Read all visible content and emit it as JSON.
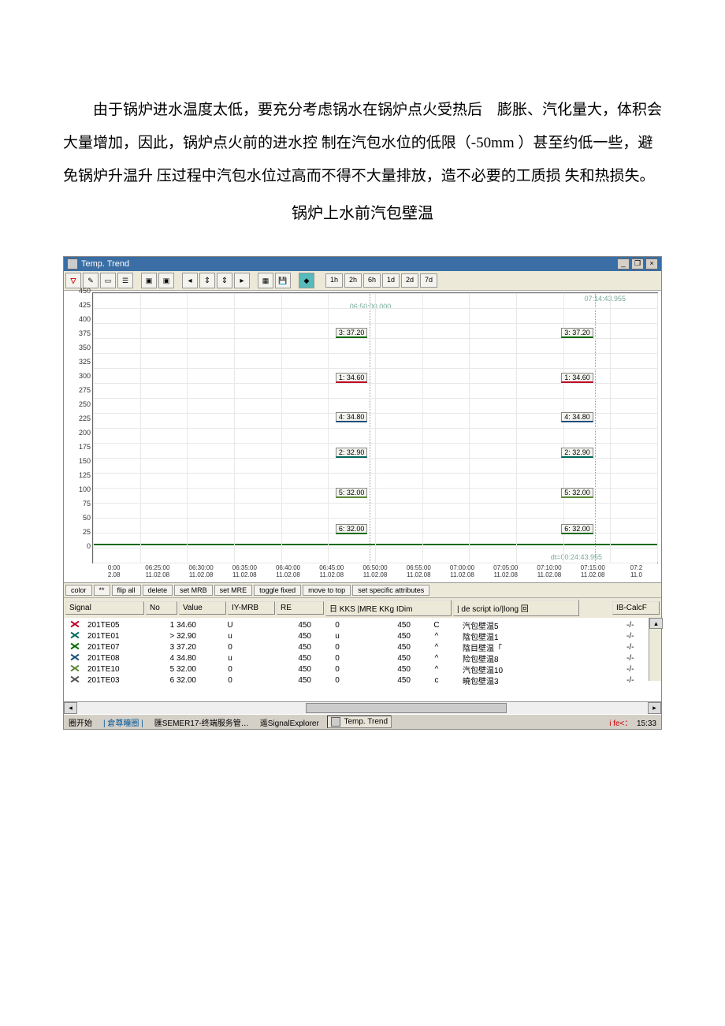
{
  "document": {
    "paragraph": "由于锅炉进水温度太低，要充分考虑锅水在锅炉点火受热后　膨胀、汽化量大，体积会大量增加，因此，锅炉点火前的进水控 制在汽包水位的低限（-50mm ）甚至约低一些，避免锅炉升温升 压过程中汽包水位过高而不得不大量排放，造不必要的工质损 失和热损失。",
    "caption": "锅炉上水前汽包壁温"
  },
  "window": {
    "title": "Temp. Trend",
    "toolbar_time_buttons": [
      "1h",
      "2h",
      "6h",
      "1d",
      "2d",
      "7d"
    ],
    "top_right_label": "07:14:43.955",
    "cursor_time": "06:50:00.000",
    "dt_label": "dt=00:24:43.955"
  },
  "chart_data": {
    "type": "line",
    "ylim": [
      0,
      450
    ],
    "yticks": [
      0,
      25,
      50,
      75,
      100,
      125,
      150,
      175,
      200,
      225,
      250,
      275,
      300,
      325,
      350,
      375,
      400,
      425,
      450
    ],
    "x_ticks": [
      {
        "t": "0:00",
        "d": "2.08"
      },
      {
        "t": "06:25:00",
        "d": "11.02.08"
      },
      {
        "t": "06:30:00",
        "d": "11.02.08"
      },
      {
        "t": "06:35:00",
        "d": "11.02.08"
      },
      {
        "t": "06:40:00",
        "d": "11.02.08"
      },
      {
        "t": "06:45:00",
        "d": "11.02.08"
      },
      {
        "t": "06:50:00",
        "d": "11.02.08"
      },
      {
        "t": "06:55:00",
        "d": "11.02.08"
      },
      {
        "t": "07:00:00",
        "d": "11.02.08"
      },
      {
        "t": "07:05:00",
        "d": "11.02.08"
      },
      {
        "t": "07:10:00",
        "d": "11.02.08"
      },
      {
        "t": "07:15:00",
        "d": "11.02.08"
      },
      {
        "t": "07:2",
        "d": "11.0"
      }
    ],
    "cursor_labels_left": [
      {
        "n": "3",
        "v": "37.20",
        "y": 375,
        "cls": "l3"
      },
      {
        "n": "1",
        "v": "34.60",
        "y": 300,
        "cls": "l1"
      },
      {
        "n": "4",
        "v": "34.80",
        "y": 235,
        "cls": "l4"
      },
      {
        "n": "2",
        "v": "32.90",
        "y": 175,
        "cls": "l2"
      },
      {
        "n": "5",
        "v": "32.00",
        "y": 108,
        "cls": "l5"
      },
      {
        "n": "6",
        "v": "32.00",
        "y": 48,
        "cls": "l6"
      }
    ],
    "cursor_labels_right": [
      {
        "n": "3",
        "v": "37.20",
        "y": 375,
        "cls": "l3"
      },
      {
        "n": "1",
        "v": "34.60",
        "y": 300,
        "cls": "l1"
      },
      {
        "n": "4",
        "v": "34.80",
        "y": 235,
        "cls": "l4"
      },
      {
        "n": "2",
        "v": "32.90",
        "y": 175,
        "cls": "l2"
      },
      {
        "n": "5",
        "v": "32.00",
        "y": 108,
        "cls": "l5"
      },
      {
        "n": "6",
        "v": "32.00",
        "y": 48,
        "cls": "l6"
      }
    ],
    "x_label_prefix": "0:00"
  },
  "button_row": [
    "color",
    "**",
    "flip all",
    "delete",
    "set MRB",
    "set MRE",
    "toggle fixed",
    "move to top",
    "set specific attributes"
  ],
  "header_row": {
    "signal": "Signal",
    "no": "No",
    "value": "Value",
    "ymrb": "IY-MRB",
    "re": "RE",
    "kks": "日 KKS |MRE KKg IDim",
    "desc": "| de script io/|long 回",
    "calc": "IB-CalcF"
  },
  "signals": [
    {
      "cls": "c1",
      "name": "201TE05",
      "no": "1",
      "val": "34.60",
      "c4": "U",
      "c5": "450",
      "c6": "0",
      "c7": "450",
      "c8": "C",
      "desc": "汽包壁温5",
      "calc": "-/-"
    },
    {
      "cls": "c2",
      "name": "201TE01",
      "no": ">",
      "val": "32.90",
      "c4": "u",
      "c5": "450",
      "c6": "u",
      "c7": "450",
      "c8": "^",
      "desc": "陰包壁温1",
      "calc": "-/-"
    },
    {
      "cls": "c3",
      "name": "201TE07",
      "no": "3",
      "val": "37.20",
      "c4": "0",
      "c5": "450",
      "c6": "0",
      "c7": "450",
      "c8": "^",
      "desc": "陰目壁温「",
      "calc": "-/-"
    },
    {
      "cls": "c4",
      "name": "201TE08",
      "no": "4",
      "val": "34.80",
      "c4": "u",
      "c5": "450",
      "c6": "0",
      "c7": "450",
      "c8": "^",
      "desc": "险包壁温8",
      "calc": "-/-"
    },
    {
      "cls": "c5",
      "name": "201TE10",
      "no": "5",
      "val": "32.00",
      "c4": "0",
      "c5": "450",
      "c6": "0",
      "c7": "450",
      "c8": "^",
      "desc": "汽包壁温10",
      "calc": "-/-"
    },
    {
      "cls": "c6",
      "name": "201TE03",
      "no": "6",
      "val": "32.00",
      "c4": "0",
      "c5": "450",
      "c6": "0",
      "c7": "450",
      "c8": "c",
      "desc": "曉包壁温3",
      "calc": "-/-"
    }
  ],
  "taskbar": {
    "start": "圈开始",
    "item1": "| 倉尊瞳圈 |",
    "item2": "匯SEMER17-终端服务管…",
    "item3": "遥SignalExplorer",
    "active": "Temp. Trend",
    "lang": "i fe<：",
    "time": "15:33"
  }
}
